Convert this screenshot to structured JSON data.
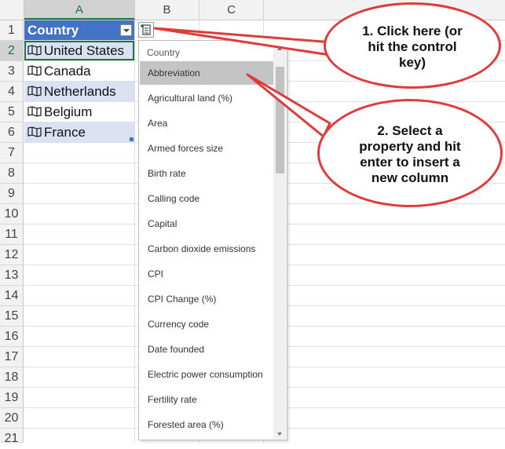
{
  "sheet": {
    "columns": [
      "A",
      "B",
      "C"
    ],
    "rows": [
      "1",
      "2",
      "3",
      "4",
      "5",
      "6",
      "7",
      "8",
      "9",
      "10",
      "11",
      "12",
      "13",
      "14",
      "15",
      "16",
      "17",
      "18",
      "19",
      "20",
      "21"
    ],
    "header_cell": "Country",
    "countries": [
      "United States",
      "Canada",
      "Netherlands",
      "Belgium",
      "France"
    ]
  },
  "dropdown": {
    "title": "Country",
    "items": [
      "Abbreviation",
      "Agricultural land (%)",
      "Area",
      "Armed forces size",
      "Birth rate",
      "Calling code",
      "Capital",
      "Carbon dioxide emissions",
      "CPI",
      "CPI Change (%)",
      "Currency code",
      "Date founded",
      "Electric power consumption",
      "Fertility rate",
      "Forested area (%)"
    ],
    "highlighted_index": 0
  },
  "callouts": {
    "first": [
      "1. Click here (or",
      "hit the control",
      "key)"
    ],
    "second": [
      "2. Select a",
      "property and hit",
      "enter to insert a",
      "new column"
    ]
  },
  "colors": {
    "accent_green": "#217346",
    "table_header_blue": "#4472c4",
    "band_blue": "#d9e1f2",
    "callout_red": "#e03b3b"
  },
  "icons": [
    "map-icon",
    "filter-dropdown-icon",
    "insert-data-icon"
  ]
}
